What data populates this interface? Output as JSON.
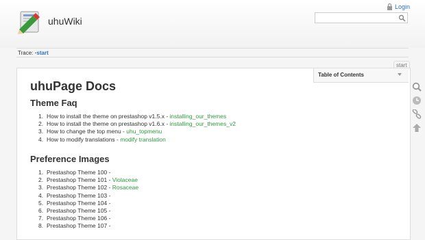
{
  "header": {
    "wiki_title": "uhuWiki",
    "login_label": "Login",
    "search_value": ""
  },
  "breadcrumb": {
    "label": "Trace:",
    "separator": "•",
    "items": [
      "start"
    ]
  },
  "page_id": "start",
  "toc": {
    "title": "Table of Contents"
  },
  "page": {
    "title": "uhuPage Docs",
    "sections": [
      {
        "heading": "Theme Faq",
        "items": [
          {
            "num": "1.",
            "text": "How to install the theme on prestashop v1.5.x - ",
            "link": "installing_our_themes"
          },
          {
            "num": "2.",
            "text": "How to install the theme on prestashop v1.6.x - ",
            "link": "installing_our_themes_v2"
          },
          {
            "num": "3.",
            "text": "How to change the top menu - ",
            "link": "uhu_topmenu"
          },
          {
            "num": "4.",
            "text": "How to modify translations - ",
            "link": "modify translation"
          }
        ]
      },
      {
        "heading": "Preference Images",
        "items": [
          {
            "num": "1.",
            "text": "Prestashop Theme 100 -",
            "link": ""
          },
          {
            "num": "2.",
            "text": "Prestashop Theme 101 - ",
            "link": "Violaceae"
          },
          {
            "num": "3.",
            "text": "Prestashop Theme 102 - ",
            "link": "Rosaceae"
          },
          {
            "num": "4.",
            "text": "Prestashop Theme 103 -",
            "link": ""
          },
          {
            "num": "5.",
            "text": "Prestashop Theme 104 -",
            "link": ""
          },
          {
            "num": "6.",
            "text": "Prestashop Theme 105 -",
            "link": ""
          },
          {
            "num": "7.",
            "text": "Prestashop Theme 106 -",
            "link": ""
          },
          {
            "num": "8.",
            "text": "Prestashop Theme 107 -",
            "link": ""
          }
        ]
      }
    ]
  },
  "tools": [
    "search-icon",
    "revisions-icon",
    "backlinks-icon",
    "back-to-top-icon"
  ],
  "colors": {
    "link_internal": "#2e9a3f",
    "link_nav": "#2b73b7",
    "border": "#dddddd"
  }
}
